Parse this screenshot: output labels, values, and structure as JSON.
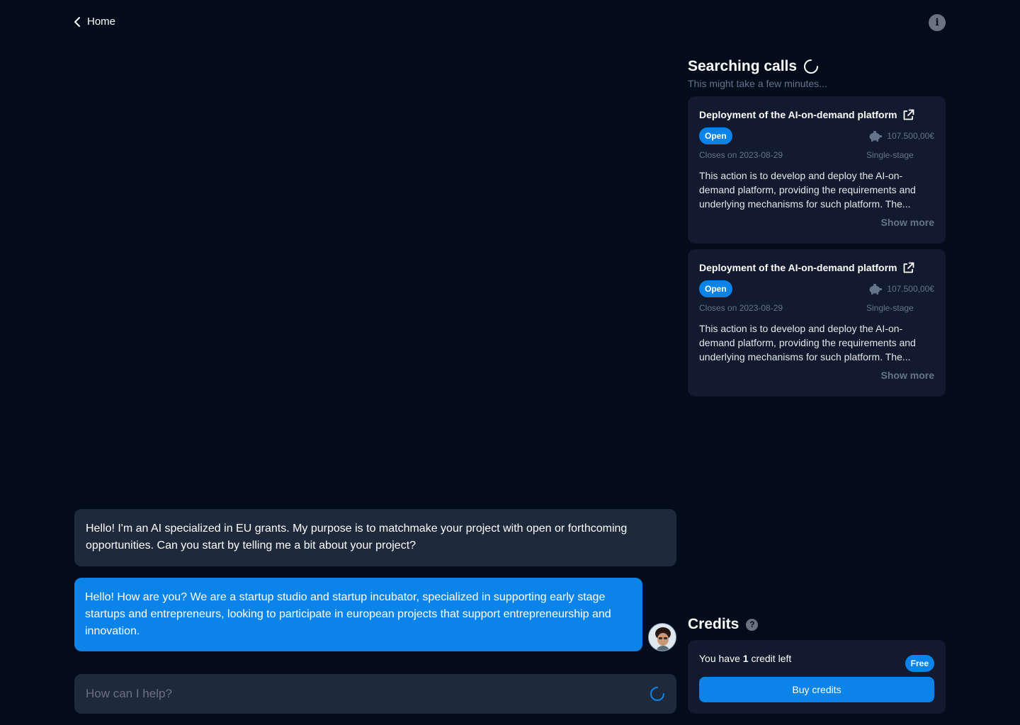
{
  "nav": {
    "back_label": "Home"
  },
  "chat": {
    "ai_message": "Hello! I'm an AI specialized in EU grants. My purpose is to matchmake your project with open or forthcoming opportunities. Can you start by telling me a bit about your project?",
    "user_message": "Hello! How are you? We are a startup studio and startup incubator, specialized in supporting early stage startups and entrepreneurs, looking to participate in european projects that support entrepreneurship and innovation.",
    "input_placeholder": "How can I help?"
  },
  "search": {
    "title": "Searching calls",
    "subtitle": "This might take a few minutes..."
  },
  "calls": [
    {
      "title": "Deployment of the AI-on-demand platform",
      "status": "Open",
      "budget": "107.500,00€",
      "closes": "Closes on 2023-08-29",
      "stage": "Single-stage",
      "description": "This action is to develop and deploy the AI-on-demand platform, providing the requirements and underlying mechanisms for such platform. The...",
      "show_more": "Show more"
    },
    {
      "title": "Deployment of the AI-on-demand platform",
      "status": "Open",
      "budget": "107.500,00€",
      "closes": "Closes on 2023-08-29",
      "stage": "Single-stage",
      "description": "This action is to develop and deploy the AI-on-demand platform, providing the requirements and underlying mechanisms for such platform. The...",
      "show_more": "Show more"
    }
  ],
  "credits": {
    "title": "Credits",
    "text_before": "You have ",
    "count": "1",
    "text_after": " credit left",
    "plan_badge": "Free",
    "buy_label": "Buy credits"
  },
  "colors": {
    "background": "#020c1b",
    "surface": "#1e293b",
    "card": "#111a2e",
    "accent": "#0b84ea",
    "muted": "#64748b"
  }
}
